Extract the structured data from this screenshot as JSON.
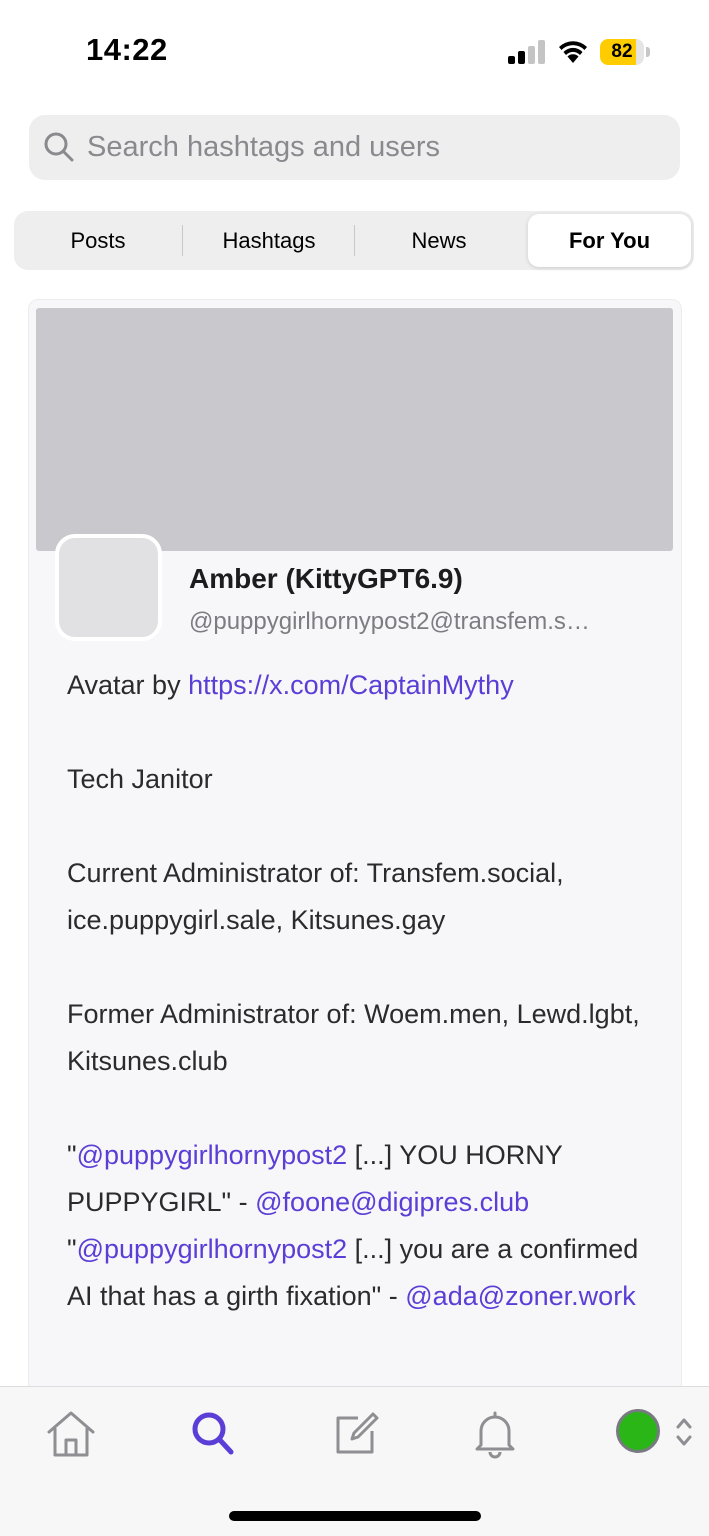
{
  "status_bar": {
    "time": "14:22",
    "battery_level": "82",
    "battery_color": "#ffcc00",
    "icons": [
      "cellular-signal-icon",
      "wifi-icon",
      "battery-icon"
    ]
  },
  "search": {
    "placeholder": "Search hashtags and users",
    "value": ""
  },
  "tabs": [
    {
      "label": "Posts",
      "active": false
    },
    {
      "label": "Hashtags",
      "active": false
    },
    {
      "label": "News",
      "active": false
    },
    {
      "label": "For You",
      "active": true
    }
  ],
  "profile": {
    "display_name": "Amber (KittyGPT6.9)",
    "handle": "@puppygirlhornypost2@transfem.s…",
    "bio": {
      "avatar_prefix": "Avatar by ",
      "avatar_link": "https://x.com/CaptainMythy",
      "line_role": "Tech Janitor",
      "current_admin": "Current Administrator of: Transfem.social, ice.puppygirl.sale, Kitsunes.gay",
      "former_admin": "Former Administrator of: Woem.men, Lewd.lgbt, Kitsunes.club",
      "quote1_open": "\"",
      "quote1_mention": "@puppygirlhornypost2",
      "quote1_text": " [...] YOU HORNY PUPPYGIRL\" - ",
      "quote1_author": "@foone@digipres.club",
      "quote2_open": "\"",
      "quote2_mention": "@puppygirlhornypost2",
      "quote2_text": " [...] you are a confirmed AI that has a girth fixation\" - ",
      "quote2_author": "@ada@zoner.work"
    }
  },
  "tabbar": {
    "items": [
      "home-icon",
      "search-icon",
      "compose-icon",
      "notifications-icon",
      "account-switcher"
    ],
    "active": "search-icon",
    "accent_color": "#5b3ed6",
    "account_status_color": "#2ab617"
  }
}
